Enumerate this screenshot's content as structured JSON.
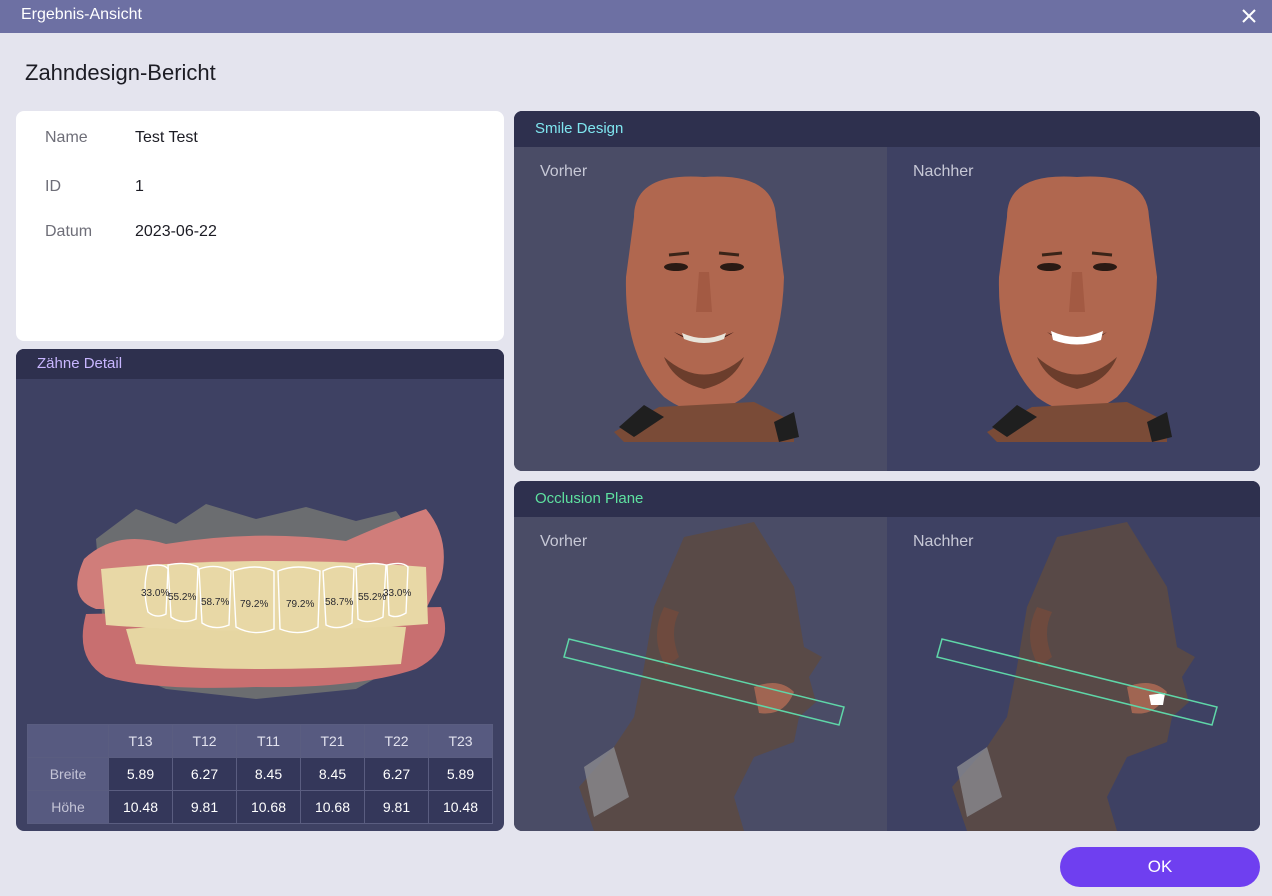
{
  "window": {
    "title": "Ergebnis-Ansicht",
    "close_icon": "close-icon"
  },
  "page_title": "Zahndesign-Bericht",
  "patient": {
    "rows": [
      {
        "label": "Name",
        "value": "Test Test"
      },
      {
        "label": "ID",
        "value": "1"
      },
      {
        "label": "Datum",
        "value": "2023-06-22"
      }
    ]
  },
  "teeth_detail": {
    "title": "Zähne Detail",
    "ratios": [
      "33.0%",
      "55.2%",
      "58.7%",
      "79.2%",
      "79.2%",
      "58.7%",
      "55.2%",
      "33.0%"
    ],
    "table": {
      "columns": [
        "T13",
        "T12",
        "T11",
        "T21",
        "T22",
        "T23"
      ],
      "rows": [
        {
          "label": "Breite",
          "values": [
            "5.89",
            "6.27",
            "8.45",
            "8.45",
            "6.27",
            "5.89"
          ]
        },
        {
          "label": "Höhe",
          "values": [
            "10.48",
            "9.81",
            "10.68",
            "10.68",
            "9.81",
            "10.48"
          ]
        }
      ]
    }
  },
  "smile_design": {
    "title": "Smile Design",
    "before": "Vorher",
    "after": "Nachher"
  },
  "occlusion_plane": {
    "title": "Occlusion Plane",
    "before": "Vorher",
    "after": "Nachher"
  },
  "ok_label": "OK",
  "colors": {
    "titlebar": "#6d70a3",
    "accent_button": "#6f3ff0",
    "teeth_title": "#c8b6ff",
    "smile_title": "#7fe6f0",
    "occlusion_title": "#5ee1a0",
    "plane_line": "#5fd6a8"
  }
}
